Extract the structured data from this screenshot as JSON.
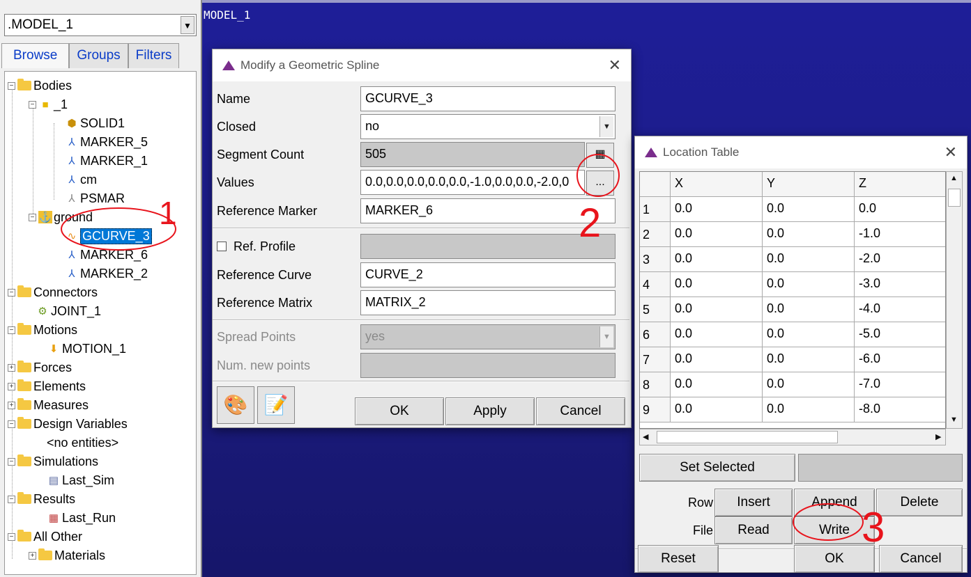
{
  "viewport": {
    "title": "MODEL_1"
  },
  "left_panel": {
    "model_selector": ".MODEL_1",
    "tabs": [
      "Browse",
      "Groups",
      "Filters"
    ],
    "tree": {
      "bodies": "Bodies",
      "part_1": "_1",
      "solid1": "SOLID1",
      "marker_5": "MARKER_5",
      "marker_1": "MARKER_1",
      "cm": "cm",
      "psmar": "PSMAR",
      "ground": "ground",
      "gcurve_3": "GCURVE_3",
      "marker_6": "MARKER_6",
      "marker_2": "MARKER_2",
      "connectors": "Connectors",
      "joint_1": "JOINT_1",
      "motions": "Motions",
      "motion_1": "MOTION_1",
      "forces": "Forces",
      "elements": "Elements",
      "measures": "Measures",
      "design_variables": "Design Variables",
      "no_entities": "<no entities>",
      "simulations": "Simulations",
      "last_sim": "Last_Sim",
      "results": "Results",
      "last_run": "Last_Run",
      "all_other": "All Other",
      "materials": "Materials"
    }
  },
  "modify_dialog": {
    "title": "Modify a Geometric Spline",
    "fields": {
      "name_label": "Name",
      "name_value": "GCURVE_3",
      "closed_label": "Closed",
      "closed_value": "no",
      "segment_label": "Segment Count",
      "segment_value": "505",
      "values_label": "Values",
      "values_value": "0.0,0.0,0.0,0.0,0.0,-1.0,0.0,0.0,-2.0,0",
      "values_button": "...",
      "ref_marker_label": "Reference Marker",
      "ref_marker_value": "MARKER_6",
      "ref_profile_label": "Ref. Profile",
      "ref_curve_label": "Reference Curve",
      "ref_curve_value": "CURVE_2",
      "ref_matrix_label": "Reference Matrix",
      "ref_matrix_value": "MATRIX_2",
      "spread_label": "Spread Points",
      "spread_value": "yes",
      "num_new_label": "Num. new points"
    },
    "buttons": {
      "ok": "OK",
      "apply": "Apply",
      "cancel": "Cancel"
    }
  },
  "location_table": {
    "title": "Location Table",
    "columns": [
      "X",
      "Y",
      "Z"
    ],
    "rows": [
      [
        "1",
        "0.0",
        "0.0",
        "0.0"
      ],
      [
        "2",
        "0.0",
        "0.0",
        "-1.0"
      ],
      [
        "3",
        "0.0",
        "0.0",
        "-2.0"
      ],
      [
        "4",
        "0.0",
        "0.0",
        "-3.0"
      ],
      [
        "5",
        "0.0",
        "0.0",
        "-4.0"
      ],
      [
        "6",
        "0.0",
        "0.0",
        "-5.0"
      ],
      [
        "7",
        "0.0",
        "0.0",
        "-6.0"
      ],
      [
        "8",
        "0.0",
        "0.0",
        "-7.0"
      ],
      [
        "9",
        "0.0",
        "0.0",
        "-8.0"
      ]
    ],
    "set_selected": "Set Selected",
    "row_label": "Row",
    "insert": "Insert",
    "append": "Append",
    "delete": "Delete",
    "file_label": "File",
    "read": "Read",
    "write": "Write",
    "reset": "Reset",
    "ok": "OK",
    "cancel": "Cancel"
  },
  "annotations": {
    "one": "1",
    "two": "2",
    "three": "3",
    "color": "#e8141c"
  }
}
